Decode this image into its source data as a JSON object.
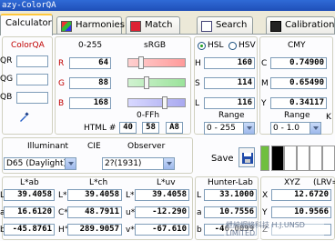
{
  "window": {
    "title": "azy-ColorQA"
  },
  "tabs": [
    {
      "label": "Calculator",
      "icon": "calculator-icon"
    },
    {
      "label": "Harmonies",
      "icon": "harmonies-icon"
    },
    {
      "label": "Match",
      "icon": "match-icon"
    },
    {
      "label": "Search",
      "icon": "search-icon"
    },
    {
      "label": "Calibration",
      "icon": "calibration-icon"
    }
  ],
  "colorqa": {
    "title": "ColorQA",
    "labels": [
      "QR",
      "QG",
      "QB"
    ],
    "values": [
      "",
      "",
      ""
    ]
  },
  "rgb": {
    "range_label": "0-255",
    "srgb_label": "sRGB",
    "channels": [
      {
        "label": "R",
        "value": "64"
      },
      {
        "label": "G",
        "value": "88"
      },
      {
        "label": "B",
        "value": "168"
      }
    ],
    "hex_range_label": "0-FFh",
    "html_label": "HTML #",
    "hex": [
      "40",
      "58",
      "A8"
    ]
  },
  "hsl": {
    "mode_hsl": "HSL",
    "mode_hsv": "HSV",
    "channels": [
      {
        "label": "H",
        "value": "160"
      },
      {
        "label": "S",
        "value": "114"
      },
      {
        "label": "L",
        "value": "116"
      }
    ],
    "range_label": "Range",
    "range_value": "0 - 255"
  },
  "cmy": {
    "title": "CMY",
    "channels": [
      {
        "label": "C",
        "value": "0.74900"
      },
      {
        "label": "M",
        "value": "0.65490"
      },
      {
        "label": "Y",
        "value": "0.34117"
      }
    ],
    "range_label": "Range",
    "range_value": "0 - 1.0",
    "k_label": "K"
  },
  "illuminant": {
    "label": "Illuminant",
    "value": "D65 (Daylight)",
    "cie_label": "CIE",
    "observer_label": "Observer",
    "observer_value": "2?(1931)"
  },
  "save": {
    "label": "Save"
  },
  "lab": {
    "headers": [
      "L*ab",
      "L*ch",
      "L*uv"
    ],
    "rows": [
      {
        "labels": [
          "L*",
          "L*",
          "L*"
        ],
        "values": [
          "39.4058",
          "39.4058",
          "39.4058"
        ]
      },
      {
        "labels": [
          "a*",
          "C*",
          "u*"
        ],
        "values": [
          "16.6120",
          "48.7911",
          "-12.290"
        ]
      },
      {
        "labels": [
          "b*",
          "H°",
          "v*"
        ],
        "values": [
          "-45.8761",
          "289.9057",
          "-67.610"
        ]
      }
    ]
  },
  "hunter": {
    "title": "Hunter-Lab",
    "rows": [
      {
        "label": "L",
        "value": "33.1000"
      },
      {
        "label": "a",
        "value": "10.7556"
      },
      {
        "label": "b",
        "value": "-46.0099"
      }
    ]
  },
  "xyz": {
    "title": "XYZ",
    "extra_label": "(LRV=",
    "rows": [
      {
        "label": "X",
        "value": "12.6720"
      },
      {
        "label": "Y",
        "value": "10.9566"
      },
      {
        "label": "Z",
        "value": ""
      }
    ]
  },
  "watermark": "紲紳網絡科技 H.J.UNSD LIMITED",
  "colors": {
    "swatch": "#4058a8",
    "accent_tab": "#ffc83c",
    "label_red": "#c00000"
  }
}
